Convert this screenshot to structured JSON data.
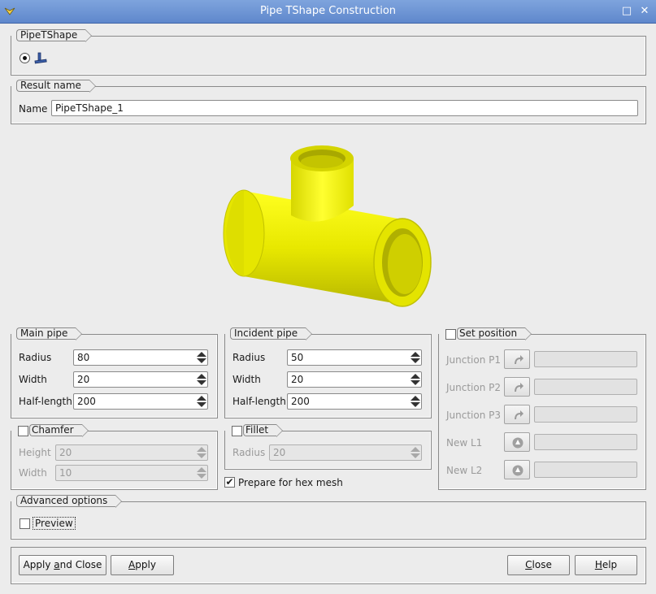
{
  "window": {
    "title": "Pipe TShape Construction"
  },
  "constructor_group": {
    "label": "PipeTShape",
    "icon": "pipe-tshape-icon"
  },
  "result_group": {
    "label": "Result name",
    "name_label": "Name",
    "name_value": "PipeTShape_1"
  },
  "preview_image": {
    "color": "#f0f000"
  },
  "main_pipe": {
    "label": "Main pipe",
    "radius_label": "Radius",
    "radius_value": "80",
    "width_label": "Width",
    "width_value": "20",
    "half_length_label": "Half-length",
    "half_length_value": "200"
  },
  "incident_pipe": {
    "label": "Incident pipe",
    "radius_label": "Radius",
    "radius_value": "50",
    "width_label": "Width",
    "width_value": "20",
    "half_length_label": "Half-length",
    "half_length_value": "200"
  },
  "set_position": {
    "label": "Set position",
    "junction_p1": "Junction P1",
    "junction_p2": "Junction P2",
    "junction_p3": "Junction P3",
    "new_l1": "New L1",
    "new_l2": "New L2"
  },
  "chamfer": {
    "label": "Chamfer",
    "height_label": "Height",
    "height_value": "20",
    "width_label": "Width",
    "width_value": "10"
  },
  "fillet": {
    "label": "Fillet",
    "radius_label": "Radius",
    "radius_value": "20"
  },
  "hex_mesh": {
    "label": "Prepare for hex mesh",
    "checked": true,
    "check_mark": "✔"
  },
  "advanced": {
    "label": "Advanced options",
    "preview_label": "Preview"
  },
  "buttons": {
    "apply_close_pre": "Apply ",
    "apply_close_mid": "a",
    "apply_close_post": "nd Close",
    "apply_u": "A",
    "apply_rest": "pply",
    "close_u": "C",
    "close_rest": "lose",
    "help_u": "H",
    "help_rest": "elp"
  },
  "titlebar_buttons": {
    "maximize": "□",
    "close": "✕"
  }
}
